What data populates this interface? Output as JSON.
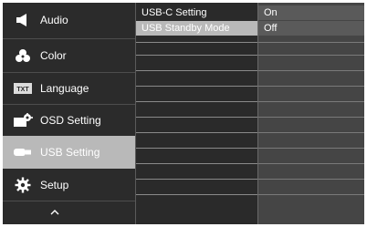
{
  "menu": {
    "items": [
      {
        "label": "Audio",
        "icon": "speaker-icon"
      },
      {
        "label": "Color",
        "icon": "color-dots-icon"
      },
      {
        "label": "Language",
        "icon": "txt-language-icon"
      },
      {
        "label": "OSD Setting",
        "icon": "osd-gear-icon"
      },
      {
        "label": "USB Setting",
        "icon": "usb-plug-icon",
        "active": true
      },
      {
        "label": "Setup",
        "icon": "gear-icon"
      }
    ],
    "scroll_up_icon": "chevron-up-icon",
    "language_icon_text": "TXT"
  },
  "submenu": {
    "items": [
      {
        "label": "USB-C Setting"
      },
      {
        "label": "USB Standby Mode",
        "active": true
      }
    ]
  },
  "values": {
    "items": [
      {
        "label": "On"
      },
      {
        "label": "Off"
      }
    ]
  },
  "colors": {
    "background": "#2a2a2a",
    "highlight": "#b9b9b9",
    "value_column": "#454545"
  }
}
